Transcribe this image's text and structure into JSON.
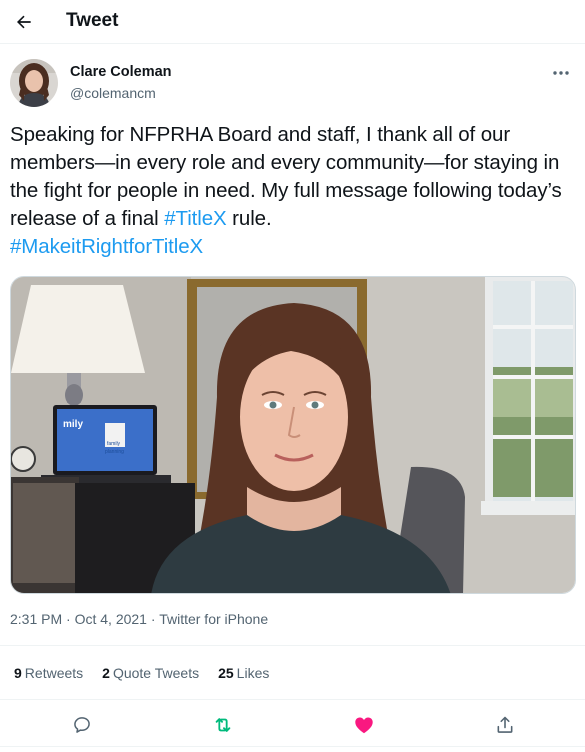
{
  "header": {
    "title": "Tweet"
  },
  "author": {
    "name": "Clare Coleman",
    "handle": "@colemancm"
  },
  "tweet": {
    "text_plain": "Speaking for NFPRHA Board and staff, I thank all of our members—in every role and every community—for staying in the fight for people in need. My full message following today’s release of a final ",
    "hashtag_1": "#TitleX",
    "text_after": " rule.",
    "hashtag_2": "#MakeitRightforTitleX"
  },
  "meta": {
    "time": "2:31 PM",
    "date": "Oct 4, 2021",
    "source": "Twitter for iPhone",
    "separator": "·"
  },
  "stats": {
    "retweets_count": "9",
    "retweets_label": "Retweets",
    "quotes_count": "2",
    "quotes_label": "Quote Tweets",
    "likes_count": "25",
    "likes_label": "Likes"
  },
  "media_text": {
    "screen_line_1": "mily",
    "screen_line_2": "family",
    "screen_line_3": "planning"
  },
  "colors": {
    "link": "#1d9bf0",
    "retweet_active": "#00ba7c",
    "like_active": "#f91880",
    "secondary": "#536471"
  },
  "icons": {
    "back": "arrow-left-icon",
    "more": "more-horizontal-icon",
    "reply": "reply-icon",
    "retweet": "retweet-icon",
    "like": "heart-icon",
    "share": "share-icon"
  }
}
